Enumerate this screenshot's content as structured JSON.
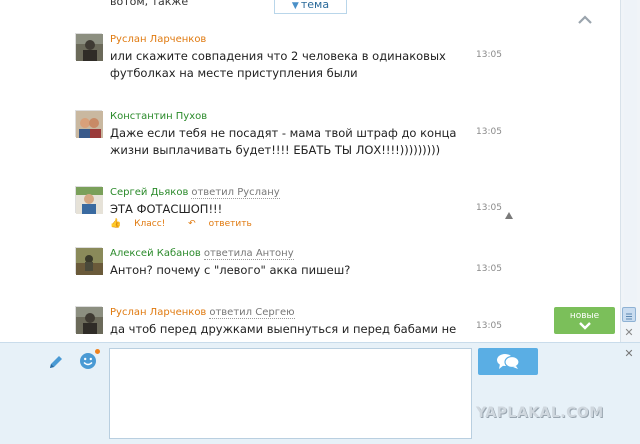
{
  "top_fragment": "вотом, также",
  "topic_tab": {
    "label": "тема"
  },
  "messages": [
    {
      "author": "Руслан Ларченков",
      "author_color": "#e07a10",
      "reply_to": "",
      "text_lines": [
        "или скажите совпадения что 2 человека в одинаковых",
        "футболках на месте приступления были"
      ],
      "time": "13:05"
    },
    {
      "author": "Константин Пухов",
      "author_color": "#2a8a2a",
      "reply_to": "",
      "text_lines": [
        "Даже если тебя не посадят - мама твой штраф до конца",
        "жизни выплачивать будет!!!! ЕБАТЬ ТЫ ЛОХ!!!!)))))))))"
      ],
      "time": "13:05"
    },
    {
      "author": "Сергей Дьяков",
      "author_color": "#2a8a2a",
      "reply_to": "ответил Руслану",
      "text_lines": [
        "ЭТА ФОТАСШОП!!!"
      ],
      "time": "13:05",
      "actions": {
        "like": "Класс!",
        "reply": "ответить"
      }
    },
    {
      "author": "Алексей Кабанов",
      "author_color": "#2a8a2a",
      "reply_to": "ответила Антону",
      "text_lines": [
        "Антон? почему с \"левого\" акка пишеш?"
      ],
      "time": "13:05"
    },
    {
      "author": "Руслан Ларченков",
      "author_color": "#e07a10",
      "reply_to": "ответил Сергею",
      "text_lines": [
        "да чтоб перед дружками выепнуться и перед бабами не"
      ],
      "time": "13:05"
    }
  ],
  "new_button": {
    "label": "новые"
  },
  "watermark": "YAPLAKAL.COM",
  "icons": {
    "collapse": "chevron-up-icon",
    "pen": "pen-icon",
    "smile": "smile-icon",
    "send": "chat-bubbles-icon",
    "warn": "triangle-icon"
  }
}
